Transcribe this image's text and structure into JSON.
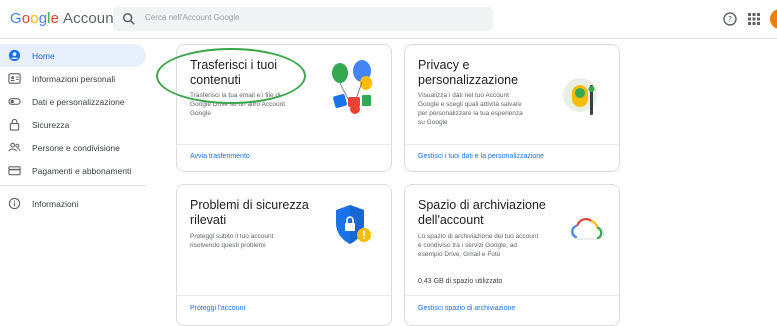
{
  "header": {
    "logo_google": [
      "G",
      "o",
      "o",
      "g",
      "l",
      "e"
    ],
    "logo_account": "Account",
    "search_placeholder": "Cerca nell'Account Google"
  },
  "sidebar": {
    "items": [
      {
        "label": "Home",
        "icon": "home-icon",
        "active": true
      },
      {
        "label": "Informazioni personali",
        "icon": "id-card-icon"
      },
      {
        "label": "Dati e personalizzazione",
        "icon": "toggle-icon"
      },
      {
        "label": "Sicurezza",
        "icon": "lock-icon"
      },
      {
        "label": "Persone e condivisione",
        "icon": "people-icon"
      },
      {
        "label": "Pagamenti e abbonamenti",
        "icon": "card-icon"
      },
      {
        "label": "Informazioni",
        "icon": "info-icon"
      }
    ]
  },
  "cards": {
    "transfer": {
      "title_line1": "Trasferisci i tuoi",
      "title_line2": "contenuti",
      "desc_line1": "Trasferisci la tua email e i file di",
      "desc_line2": "Google Drive su un altro Account",
      "desc_line3": "Google",
      "link": "Avvia trasferimento"
    },
    "privacy": {
      "title_line1": "Privacy e",
      "title_line2": "personalizzazione",
      "desc_line1": "Visualizza i dati nel tuo Account",
      "desc_line2": "Google e scegli quali attività salvare",
      "desc_line3": "per personalizzare la tua esperienza",
      "desc_line4": "su Google",
      "link": "Gestisci i tuoi dati e la personalizzazione"
    },
    "security": {
      "title_line1": "Problemi di sicurezza",
      "title_line2": "rilevati",
      "desc_line1": "Proteggi subito il tuo account",
      "desc_line2": "risolvendo questi problemi",
      "link": "Proteggi l'account"
    },
    "storage": {
      "title_line1": "Spazio di archiviazione",
      "title_line2": "dell'account",
      "desc_line1": "Lo spazio di archiviazione del tuo account",
      "desc_line2": "è condiviso tra i servizi Google, ad",
      "desc_line3": "esempio Drive, Gmail e Foto",
      "usage": "0,43 GB di spazio utilizzato",
      "link": "Gestisci spazio di archiviazione"
    }
  },
  "colors": {
    "accent_blue": "#1a73e8",
    "active_bg": "#e8f0fe",
    "annotation_green": "#3aa648",
    "avatar": "#ef7d0d"
  }
}
